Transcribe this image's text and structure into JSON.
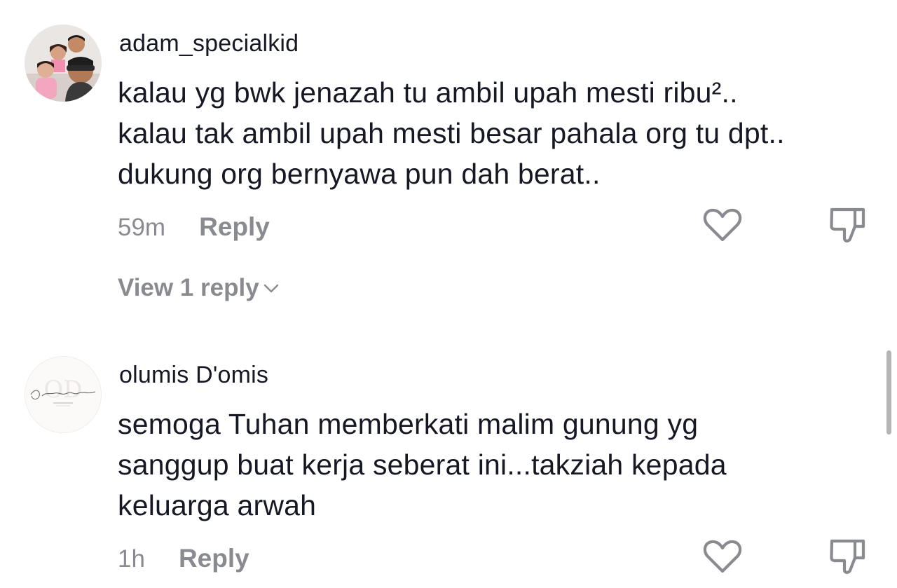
{
  "comments": [
    {
      "username": "adam_specialkid",
      "lines": [
        "kalau yg bwk jenazah tu ambil upah mesti ribu²..",
        "kalau tak ambil upah mesti besar pahala org tu dpt..",
        "dukung org bernyawa pun dah berat.."
      ],
      "time": "59m",
      "reply_label": "Reply",
      "view_replies_label": "View 1 reply"
    },
    {
      "username": "olumis D'omis",
      "lines": [
        "semoga Tuhan memberkati malim gunung yg",
        "sanggup buat kerja seberat ini...takziah kepada",
        "keluarga arwah"
      ],
      "time": "1h",
      "reply_label": "Reply"
    }
  ],
  "icons": {
    "like": "heart-outline-icon",
    "dislike": "thumbs-down-outline-icon",
    "expand": "chevron-down-icon"
  },
  "colors": {
    "text_primary": "#161823",
    "text_secondary": "#8a8b91",
    "icon": "#8a8b91"
  }
}
